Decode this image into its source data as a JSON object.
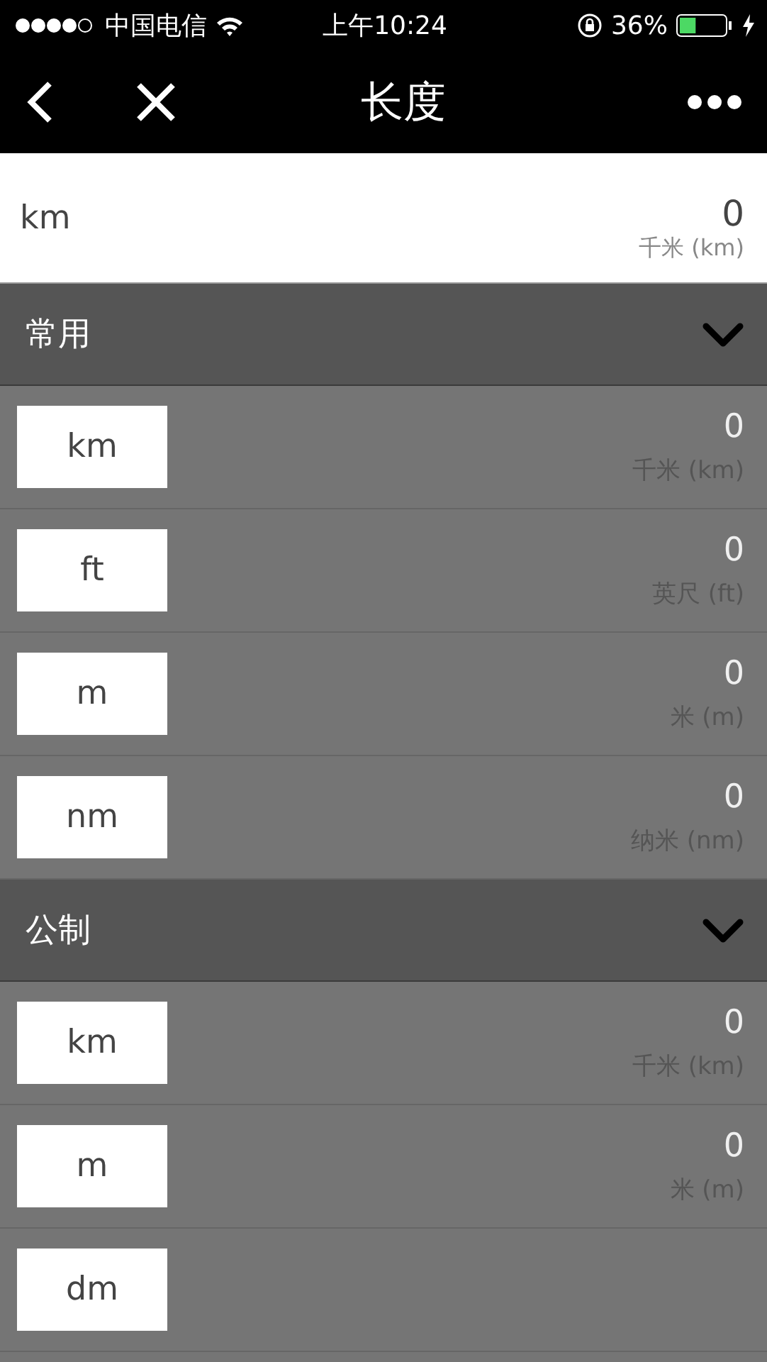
{
  "status_bar": {
    "carrier": "中国电信",
    "time": "上午10:24",
    "battery": "36%"
  },
  "nav": {
    "title": "长度"
  },
  "input": {
    "unit": "km",
    "value": "0",
    "unit_name": "千米 (km)"
  },
  "sections": [
    {
      "title": "常用",
      "expanded": true,
      "rows": [
        {
          "unit": "km",
          "value": "0",
          "unit_name": "千米 (km)"
        },
        {
          "unit": "ft",
          "value": "0",
          "unit_name": "英尺 (ft)"
        },
        {
          "unit": "m",
          "value": "0",
          "unit_name": "米 (m)"
        },
        {
          "unit": "nm",
          "value": "0",
          "unit_name": "纳米 (nm)"
        }
      ]
    },
    {
      "title": "公制",
      "expanded": true,
      "rows": [
        {
          "unit": "km",
          "value": "0",
          "unit_name": "千米 (km)"
        },
        {
          "unit": "m",
          "value": "0",
          "unit_name": "米 (m)"
        },
        {
          "unit": "dm"
        }
      ]
    }
  ]
}
